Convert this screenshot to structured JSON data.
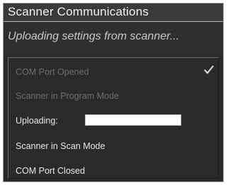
{
  "dialog": {
    "title": "Scanner Communications",
    "status": "Uploading settings from scanner..."
  },
  "steps": [
    {
      "label": "COM Port Opened",
      "state": "done"
    },
    {
      "label": "Scanner in Program Mode",
      "state": "pending"
    },
    {
      "label": "Uploading:",
      "state": "active"
    },
    {
      "label": "Scanner in Scan Mode",
      "state": "active"
    },
    {
      "label": "COM Port Closed",
      "state": "active"
    }
  ],
  "upload_progress": 0,
  "icons": {
    "step_done": "checkmark-icon"
  },
  "colors": {
    "dialog_background": "#2a2a2a",
    "title_text": "#f2f2f2",
    "status_text": "#c9c9c9",
    "step_dim": "#6f6f6f",
    "step_active": "#e8e8e8",
    "progress_track": "#ffffff"
  }
}
